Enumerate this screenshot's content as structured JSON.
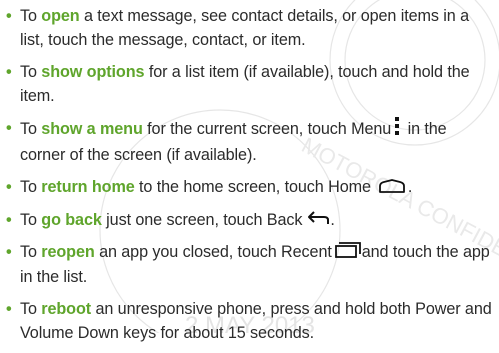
{
  "watermark": {
    "line1": "MOTOROLA CONFIDENTIAL",
    "date": "2 MAY 2013"
  },
  "accent_color": "#5fa52c",
  "tips": [
    {
      "before": "To ",
      "keyword": "open",
      "after": " a text message, see contact details, or open items in a list, touch the message, contact, or item."
    },
    {
      "before": "To ",
      "keyword": "show options",
      "after": " for a list item (if available), touch and hold the item."
    },
    {
      "before": "To ",
      "keyword": "show a menu",
      "after": " for the current screen, touch Menu",
      "icon": "menu-icon",
      "after_icon": " in the corner of the screen (if available)."
    },
    {
      "before": "To ",
      "keyword": "return home",
      "after": " to the home screen, touch Home",
      "icon": "home-icon",
      "after_icon": "."
    },
    {
      "before": "To ",
      "keyword": "go back",
      "after": " just one screen, touch Back",
      "icon": "back-icon",
      "after_icon": "."
    },
    {
      "before": "To ",
      "keyword": "reopen",
      "after": " an app you closed, touch Recent",
      "icon": "recent-apps-icon",
      "after_icon": "and touch the app in the list."
    },
    {
      "before": "To ",
      "keyword": "reboot",
      "after": " an unresponsive phone, press and hold both Power and Volume Down keys for about 15 seconds."
    }
  ]
}
